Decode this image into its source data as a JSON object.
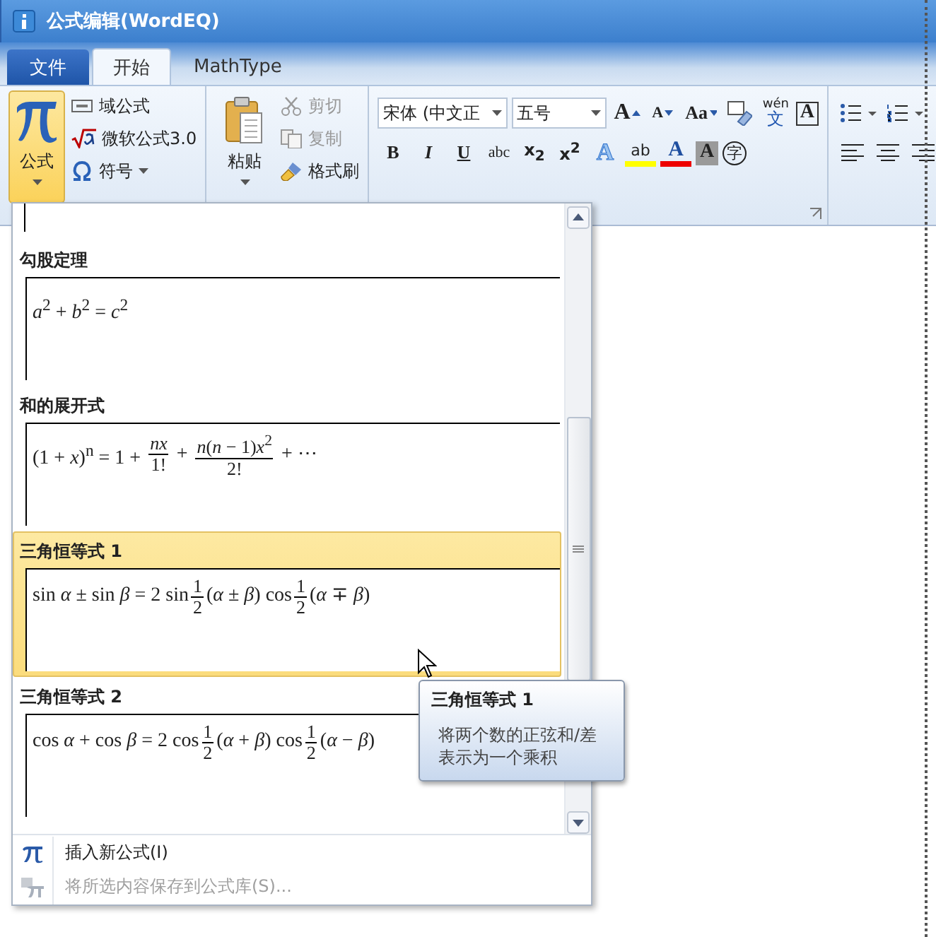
{
  "window": {
    "title": "公式编辑(WordEQ)"
  },
  "tabs": [
    {
      "label": "文件",
      "kind": "file",
      "selected": false
    },
    {
      "label": "开始",
      "kind": "tab",
      "selected": true
    },
    {
      "label": "MathType",
      "kind": "tab",
      "selected": false
    }
  ],
  "ribbon": {
    "formula": {
      "label": "公式",
      "items": [
        {
          "label": "域公式",
          "dropdown": false
        },
        {
          "label": "微软公式3.0",
          "dropdown": false
        },
        {
          "label": "符号",
          "dropdown": true
        }
      ]
    },
    "clipboard": {
      "paste": "粘贴",
      "items": [
        {
          "label": "剪切",
          "disabled": true
        },
        {
          "label": "复制",
          "disabled": true
        },
        {
          "label": "格式刷",
          "disabled": false
        }
      ]
    },
    "font": {
      "font_name": "宋体 (中文正",
      "font_size": "五号",
      "row1": [
        {
          "kind": "grow",
          "label": "A"
        },
        {
          "kind": "shrink",
          "label": "A"
        },
        {
          "kind": "case",
          "label": "Aa"
        },
        {
          "kind": "eraser"
        },
        {
          "kind": "ruby",
          "label": "文",
          "ruby": "wén"
        },
        {
          "kind": "boxed",
          "label": "A"
        }
      ],
      "row2": [
        {
          "kind": "bold",
          "label": "B"
        },
        {
          "kind": "italic",
          "label": "I"
        },
        {
          "kind": "underline",
          "label": "U"
        },
        {
          "kind": "strike",
          "label": "abc"
        },
        {
          "kind": "sub",
          "label": "x$_{2}$"
        },
        {
          "kind": "sup",
          "label": "x$^{2}$"
        },
        {
          "kind": "effect",
          "label": "A"
        },
        {
          "kind": "highlight",
          "label": "ab"
        },
        {
          "kind": "color",
          "label": "A"
        },
        {
          "kind": "shade",
          "label": "A"
        },
        {
          "kind": "enclose",
          "label": "字"
        }
      ]
    }
  },
  "gallery": {
    "items": [
      {
        "title": "勾股定理",
        "selected": false,
        "formula": [
          {
            "kind": "text",
            "text": "*a*$^{2}$ + *b*$^{2}$ = *c*$^{2}$"
          }
        ]
      },
      {
        "title": "和的展开式",
        "selected": false,
        "formula": [
          {
            "kind": "text",
            "text": "(1 + *x*)$^{n}$ = 1 + "
          },
          {
            "kind": "frac",
            "num": "*nx*",
            "den": "1!"
          },
          {
            "kind": "text",
            "text": " + "
          },
          {
            "kind": "frac",
            "num": "*n*(*n* − 1)*x*$^{2}$",
            "den": "2!"
          },
          {
            "kind": "text",
            "text": " + ⋯"
          }
        ]
      },
      {
        "title": "三角恒等式 1",
        "selected": true,
        "formula": [
          {
            "kind": "text",
            "text": "sin *α* ± sin *β* = 2 sin"
          },
          {
            "kind": "frac",
            "num": "1",
            "den": "2"
          },
          {
            "kind": "text",
            "text": "(*α* ± *β*) cos"
          },
          {
            "kind": "frac",
            "num": "1",
            "den": "2"
          },
          {
            "kind": "text",
            "text": "(*α* ∓ *β*)"
          }
        ]
      },
      {
        "title": "三角恒等式 2",
        "selected": false,
        "formula": [
          {
            "kind": "text",
            "text": "cos *α* + cos *β* = 2 cos"
          },
          {
            "kind": "frac",
            "num": "1",
            "den": "2"
          },
          {
            "kind": "text",
            "text": "(*α* + *β*) cos"
          },
          {
            "kind": "frac",
            "num": "1",
            "den": "2"
          },
          {
            "kind": "text",
            "text": "(*α* − *β*)"
          }
        ]
      }
    ]
  },
  "menu": [
    {
      "label": "插入新公式(I)",
      "disabled": false
    },
    {
      "label": "将所选内容保存到公式库(S)...",
      "disabled": true
    }
  ],
  "tooltip": {
    "title": "三角恒等式 1",
    "text": "将两个数的正弦和/差表示为一个乘积"
  }
}
